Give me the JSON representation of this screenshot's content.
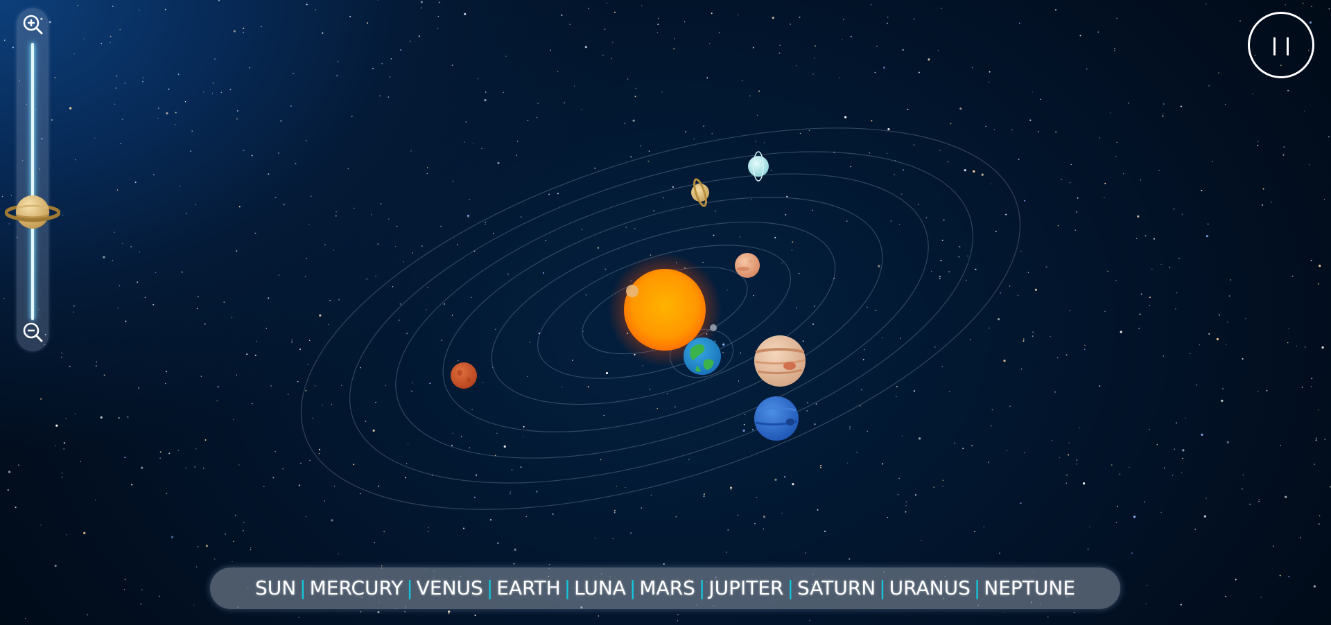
{
  "navigation": {
    "planets": [
      {
        "label": "SUN"
      },
      {
        "label": "MERCURY"
      },
      {
        "label": "VENUS"
      },
      {
        "label": "EARTH"
      },
      {
        "label": "LUNA"
      },
      {
        "label": "MARS"
      },
      {
        "label": "JUPITER"
      },
      {
        "label": "SATURN"
      },
      {
        "label": "URANUS"
      },
      {
        "label": "NEPTUNE"
      }
    ],
    "separator": "|"
  },
  "zoom": {
    "level": 0.63,
    "zoom_in_icon": "zoom-in-icon",
    "zoom_out_icon": "zoom-out-icon",
    "handle_icon": "saturn-icon"
  },
  "controls": {
    "pause_icon": "pause-icon"
  },
  "colors": {
    "separator": "#14c7dc",
    "slider_glow": "#9be8ff",
    "sun": "#ff9a00"
  }
}
